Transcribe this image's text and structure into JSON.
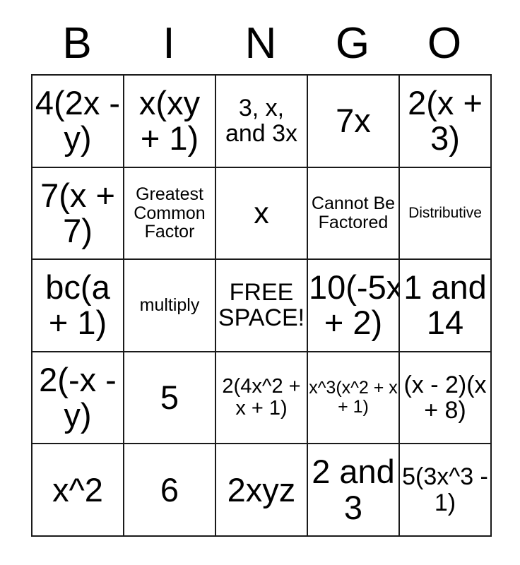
{
  "card": {
    "title_letters": [
      "B",
      "I",
      "N",
      "G",
      "O"
    ],
    "free_space_label": "FREE SPACE!",
    "grid_line_color": "#1a1a1a",
    "background_color": "#ffffff",
    "text_color": "#000000",
    "columns": 5,
    "rows": 5,
    "cells": [
      [
        {
          "text": "4(2x - y)",
          "size": "xl"
        },
        {
          "text": "x(xy + 1)",
          "size": "xl"
        },
        {
          "text": "3, x, and 3x",
          "size": "md"
        },
        {
          "text": "7x",
          "size": "xl"
        },
        {
          "text": "2(x + 3)",
          "size": "xl"
        }
      ],
      [
        {
          "text": "7(x + 7)",
          "size": "xl"
        },
        {
          "text": "Greatest Common Factor",
          "size": "xs"
        },
        {
          "text": "x",
          "size": "lg"
        },
        {
          "text": "Cannot Be Factored",
          "size": "xs"
        },
        {
          "text": "Distributive",
          "size": "xxs"
        }
      ],
      [
        {
          "text": "bc(a + 1)",
          "size": "xl"
        },
        {
          "text": "multiply",
          "size": "xs"
        },
        {
          "text": "FREE SPACE!",
          "size": "md"
        },
        {
          "text": "10(-5x + 2)",
          "size": "xl"
        },
        {
          "text": "1 and 14",
          "size": "xl"
        }
      ],
      [
        {
          "text": "2(-x - y)",
          "size": "xl"
        },
        {
          "text": "5",
          "size": "xl"
        },
        {
          "text": "2(4x^2 + x + 1)",
          "size": "sm"
        },
        {
          "text": "x^3(x^2 + x + 1)",
          "size": "xs"
        },
        {
          "text": "(x - 2)(x + 8)",
          "size": "md"
        }
      ],
      [
        {
          "text": "x^2",
          "size": "xl"
        },
        {
          "text": "6",
          "size": "xl"
        },
        {
          "text": "2xyz",
          "size": "xl"
        },
        {
          "text": "2 and 3",
          "size": "xl"
        },
        {
          "text": "5(3x^3 - 1)",
          "size": "md"
        }
      ]
    ]
  }
}
